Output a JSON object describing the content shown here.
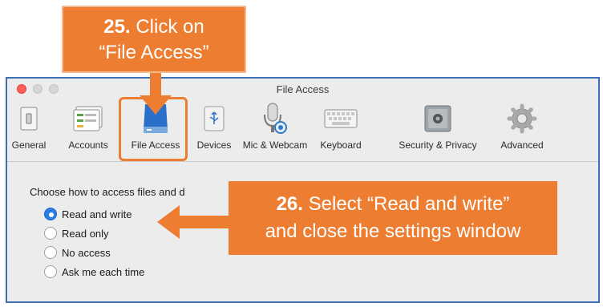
{
  "window": {
    "title": "File Access"
  },
  "toolbar": {
    "items": [
      {
        "label": "General",
        "icon": "switch-icon"
      },
      {
        "label": "Accounts",
        "icon": "accounts-icon"
      },
      {
        "label": "File Access",
        "icon": "drive-icon"
      },
      {
        "label": "Devices",
        "icon": "usb-icon"
      },
      {
        "label": "Mic & Webcam",
        "icon": "microphone-icon"
      },
      {
        "label": "Keyboard",
        "icon": "keyboard-icon"
      },
      {
        "label": "Security & Privacy",
        "icon": "safe-icon"
      },
      {
        "label": "Advanced",
        "icon": "gear-icon"
      }
    ]
  },
  "content": {
    "section_label": "Choose how to access files and d",
    "options": [
      {
        "label": "Read and write",
        "selected": true
      },
      {
        "label": "Read only",
        "selected": false
      },
      {
        "label": "No access",
        "selected": false
      },
      {
        "label": "Ask me each time",
        "selected": false
      }
    ]
  },
  "callouts": {
    "step25": {
      "number": "25.",
      "line1": "Click on",
      "line2": "“File Access”"
    },
    "step26": {
      "number": "26.",
      "line1": "Select “Read and write”",
      "line2": "and close the settings window"
    }
  },
  "colors": {
    "callout": "#ed7d31",
    "window_border": "#3c6fb4",
    "radio_selected": "#2a7ce8"
  }
}
